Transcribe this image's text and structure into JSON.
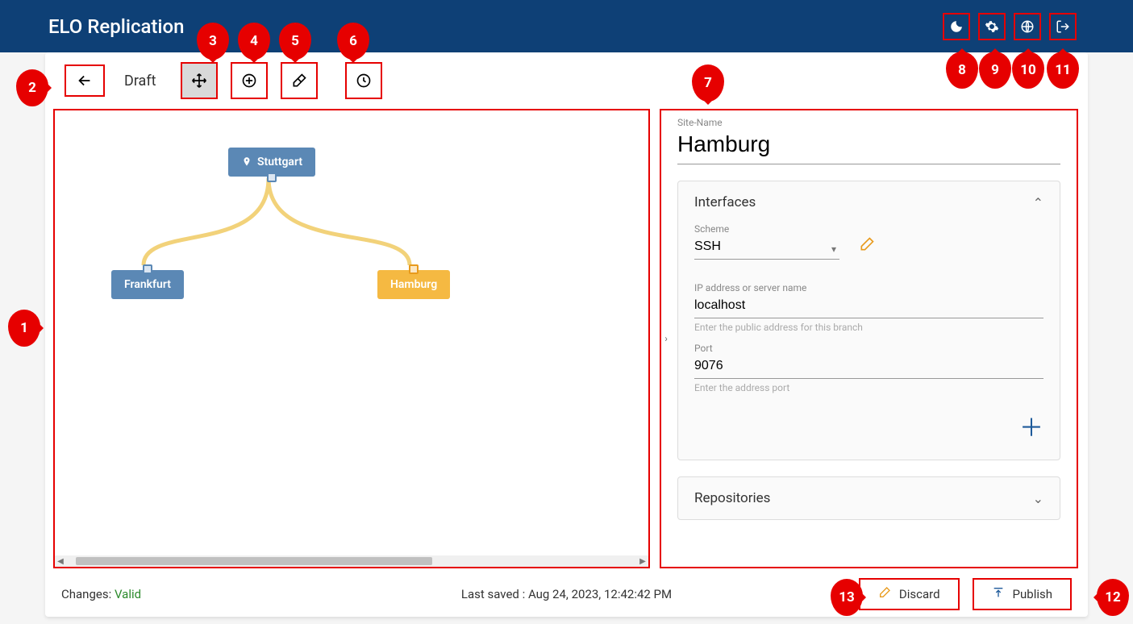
{
  "header": {
    "title": "ELO Replication"
  },
  "toolbar": {
    "status": "Draft"
  },
  "canvas": {
    "nodes": {
      "root": {
        "label": "Stuttgart"
      },
      "left": {
        "label": "Frankfurt"
      },
      "right": {
        "label": "Hamburg"
      }
    }
  },
  "detail": {
    "site_name_label": "Site-Name",
    "site_name_value": "Hamburg",
    "interfaces": {
      "title": "Interfaces",
      "scheme_label": "Scheme",
      "scheme_value": "SSH",
      "ip_label": "IP address or server name",
      "ip_value": "localhost",
      "ip_hint": "Enter the public address for this branch",
      "port_label": "Port",
      "port_value": "9076",
      "port_hint": "Enter the address port"
    },
    "repositories": {
      "title": "Repositories"
    }
  },
  "footer": {
    "changes_label": "Changes:",
    "changes_status": "Valid",
    "last_saved": "Last saved : Aug 24, 2023, 12:42:42 PM",
    "discard": "Discard",
    "publish": "Publish"
  },
  "callouts": {
    "c1": "1",
    "c2": "2",
    "c3": "3",
    "c4": "4",
    "c5": "5",
    "c6": "6",
    "c7": "7",
    "c8": "8",
    "c9": "9",
    "c10": "10",
    "c11": "11",
    "c12": "12",
    "c13": "13"
  }
}
